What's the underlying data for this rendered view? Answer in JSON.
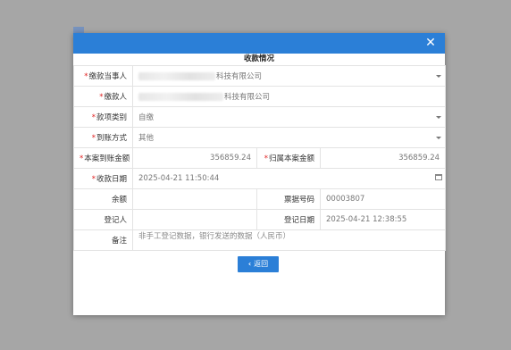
{
  "dialog": {
    "title": "收款情况",
    "close_glyph": "✕",
    "back_icon": "‹",
    "back_label": "返回"
  },
  "icons": {
    "close": "close-icon",
    "dropdown": "chevron-down-icon",
    "calendar": "calendar-icon",
    "back": "chevron-left-icon"
  },
  "colors": {
    "titlebar": "#2b7fd7",
    "required_mark": "#e02020",
    "button": "#2b7fd7"
  },
  "fields": {
    "payer_party": {
      "label": "缴款当事人",
      "value": "科技有限公司"
    },
    "payer": {
      "label": "缴款人",
      "value": "科技有限公司"
    },
    "fund_type": {
      "label": "款项类别",
      "value": "自缴"
    },
    "arrival_method": {
      "label": "到账方式",
      "value": "其他"
    },
    "arrival_amount": {
      "label": "本案到账金额",
      "value": "356859.24"
    },
    "case_amount": {
      "label": "归属本案金额",
      "value": "356859.24"
    },
    "receipt_date": {
      "label": "收款日期",
      "value": "2025-04-21 11:50:44"
    },
    "balance": {
      "label": "余额",
      "value": ""
    },
    "ticket_no": {
      "label": "票据号码",
      "value": "00003807"
    },
    "registrant": {
      "label": "登记人",
      "value": ""
    },
    "register_date": {
      "label": "登记日期",
      "value": "2025-04-21 12:38:55"
    },
    "remark": {
      "label": "备注",
      "value": "非手工登记数据，银行发送的数据（人民币）"
    }
  }
}
